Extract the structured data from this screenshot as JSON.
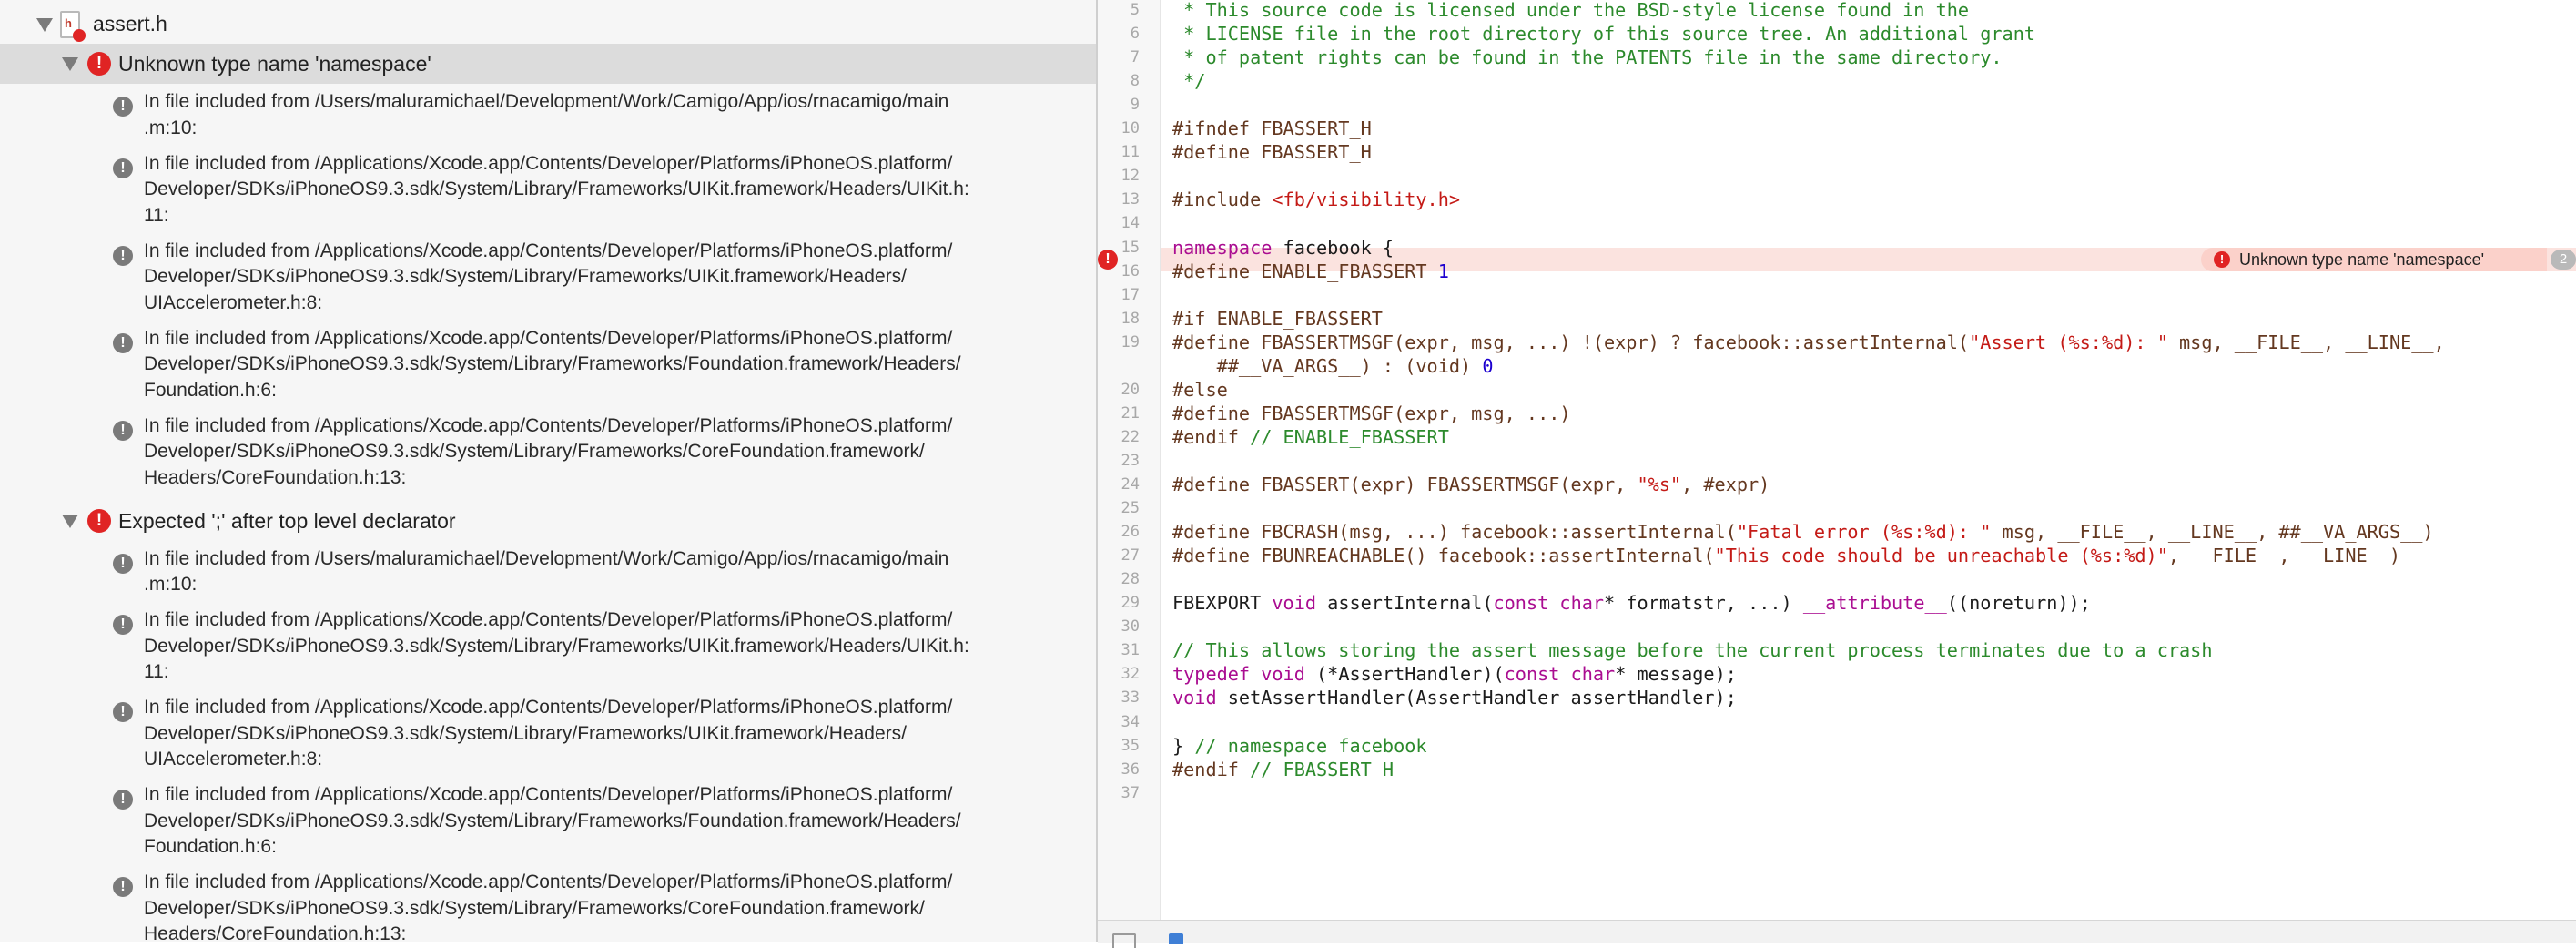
{
  "navigator": {
    "file": {
      "name": "assert.h",
      "icon": "header-file-icon"
    },
    "issues": [
      {
        "message": "Unknown type name 'namespace'",
        "notes": [
          "In file included from /Users/maluramichael/Development/Work/Camigo/App/ios/rnacamigo/main\n.m:10:",
          "In file included from /Applications/Xcode.app/Contents/Developer/Platforms/iPhoneOS.platform/\nDeveloper/SDKs/iPhoneOS9.3.sdk/System/Library/Frameworks/UIKit.framework/Headers/UIKit.h:\n11:",
          "In file included from /Applications/Xcode.app/Contents/Developer/Platforms/iPhoneOS.platform/\nDeveloper/SDKs/iPhoneOS9.3.sdk/System/Library/Frameworks/UIKit.framework/Headers/\nUIAccelerometer.h:8:",
          "In file included from /Applications/Xcode.app/Contents/Developer/Platforms/iPhoneOS.platform/\nDeveloper/SDKs/iPhoneOS9.3.sdk/System/Library/Frameworks/Foundation.framework/Headers/\nFoundation.h:6:",
          "In file included from /Applications/Xcode.app/Contents/Developer/Platforms/iPhoneOS.platform/\nDeveloper/SDKs/iPhoneOS9.3.sdk/System/Library/Frameworks/CoreFoundation.framework/\nHeaders/CoreFoundation.h:13:"
        ]
      },
      {
        "message": "Expected ';' after top level declarator",
        "notes": [
          "In file included from /Users/maluramichael/Development/Work/Camigo/App/ios/rnacamigo/main\n.m:10:",
          "In file included from /Applications/Xcode.app/Contents/Developer/Platforms/iPhoneOS.platform/\nDeveloper/SDKs/iPhoneOS9.3.sdk/System/Library/Frameworks/UIKit.framework/Headers/UIKit.h:\n11:",
          "In file included from /Applications/Xcode.app/Contents/Developer/Platforms/iPhoneOS.platform/\nDeveloper/SDKs/iPhoneOS9.3.sdk/System/Library/Frameworks/UIKit.framework/Headers/\nUIAccelerometer.h:8:",
          "In file included from /Applications/Xcode.app/Contents/Developer/Platforms/iPhoneOS.platform/\nDeveloper/SDKs/iPhoneOS9.3.sdk/System/Library/Frameworks/Foundation.framework/Headers/\nFoundation.h:6:",
          "In file included from /Applications/Xcode.app/Contents/Developer/Platforms/iPhoneOS.platform/\nDeveloper/SDKs/iPhoneOS9.3.sdk/System/Library/Frameworks/CoreFoundation.framework/\nHeaders/CoreFoundation.h:13:"
        ]
      }
    ]
  },
  "editor": {
    "inline_error": {
      "message": "Unknown type name 'namespace'",
      "count": "2",
      "line": "15"
    },
    "line_numbers": [
      "5",
      "6",
      "7",
      "8",
      "9",
      "10",
      "11",
      "12",
      "13",
      "14",
      "15",
      "16",
      "17",
      "18",
      "19",
      "",
      "20",
      "21",
      "22",
      "23",
      "24",
      "25",
      "26",
      "27",
      "28",
      "29",
      "30",
      "31",
      "32",
      "33",
      "34",
      "35",
      "36",
      "37"
    ],
    "lines": [
      [
        [
          "cmt",
          " * This source code is licensed under the BSD-style license found in the"
        ]
      ],
      [
        [
          "cmt",
          " * LICENSE file in the root directory of this source tree. An additional grant"
        ]
      ],
      [
        [
          "cmt",
          " * of patent rights can be found in the PATENTS file in the same directory."
        ]
      ],
      [
        [
          "cmt",
          " */"
        ]
      ],
      [
        [
          "ident",
          ""
        ]
      ],
      [
        [
          "pp",
          "#ifndef FBASSERT_H"
        ]
      ],
      [
        [
          "pp",
          "#define FBASSERT_H"
        ]
      ],
      [
        [
          "ident",
          ""
        ]
      ],
      [
        [
          "pp",
          "#include "
        ],
        [
          "str",
          "<fb/visibility.h>"
        ]
      ],
      [
        [
          "ident",
          ""
        ]
      ],
      [
        [
          "kw",
          "namespace"
        ],
        [
          "ident",
          " facebook {"
        ]
      ],
      [
        [
          "pp",
          "#define ENABLE_FBASSERT "
        ],
        [
          "num",
          "1"
        ]
      ],
      [
        [
          "ident",
          ""
        ]
      ],
      [
        [
          "pp",
          "#if ENABLE_FBASSERT"
        ]
      ],
      [
        [
          "pp",
          "#define FBASSERTMSGF(expr, msg, ...) !(expr) ? facebook::assertInternal("
        ],
        [
          "str",
          "\"Assert (%s:%d): \""
        ],
        [
          "pp",
          " msg, __FILE__, __LINE__,"
        ]
      ],
      [
        [
          "pp",
          "    ##__VA_ARGS__) : (void) "
        ],
        [
          "num",
          "0"
        ]
      ],
      [
        [
          "pp",
          "#else"
        ]
      ],
      [
        [
          "pp",
          "#define FBASSERTMSGF(expr, msg, ...)"
        ]
      ],
      [
        [
          "pp",
          "#endif "
        ],
        [
          "cmt",
          "// ENABLE_FBASSERT"
        ]
      ],
      [
        [
          "ident",
          ""
        ]
      ],
      [
        [
          "pp",
          "#define FBASSERT(expr) FBASSERTMSGF(expr, "
        ],
        [
          "str",
          "\"%s\""
        ],
        [
          "pp",
          ", #expr)"
        ]
      ],
      [
        [
          "ident",
          ""
        ]
      ],
      [
        [
          "pp",
          "#define FBCRASH(msg, ...) facebook::assertInternal("
        ],
        [
          "str",
          "\"Fatal error (%s:%d): \""
        ],
        [
          "pp",
          " msg, __FILE__, __LINE__, ##__VA_ARGS__)"
        ]
      ],
      [
        [
          "pp",
          "#define FBUNREACHABLE() facebook::assertInternal("
        ],
        [
          "str",
          "\"This code should be unreachable (%s:%d)\""
        ],
        [
          "pp",
          ", __FILE__, __LINE__)"
        ]
      ],
      [
        [
          "ident",
          ""
        ]
      ],
      [
        [
          "ident",
          "FBEXPORT "
        ],
        [
          "kw",
          "void"
        ],
        [
          "ident",
          " assertInternal("
        ],
        [
          "kw",
          "const"
        ],
        [
          "ident",
          " "
        ],
        [
          "kw",
          "char"
        ],
        [
          "ident",
          "* formatstr, ...) "
        ],
        [
          "kw",
          "__attribute__"
        ],
        [
          "ident",
          "((noreturn));"
        ]
      ],
      [
        [
          "ident",
          ""
        ]
      ],
      [
        [
          "cmt",
          "// This allows storing the assert message before the current process terminates due to a crash"
        ]
      ],
      [
        [
          "kw",
          "typedef"
        ],
        [
          "ident",
          " "
        ],
        [
          "kw",
          "void"
        ],
        [
          "ident",
          " (*AssertHandler)("
        ],
        [
          "kw",
          "const"
        ],
        [
          "ident",
          " "
        ],
        [
          "kw",
          "char"
        ],
        [
          "ident",
          "* message);"
        ]
      ],
      [
        [
          "kw",
          "void"
        ],
        [
          "ident",
          " setAssertHandler(AssertHandler assertHandler);"
        ]
      ],
      [
        [
          "ident",
          ""
        ]
      ],
      [
        [
          "ident",
          "} "
        ],
        [
          "cmt",
          "// namespace facebook"
        ]
      ],
      [
        [
          "pp",
          "#endif "
        ],
        [
          "cmt",
          "// FBASSERT_H"
        ]
      ],
      [
        [
          "ident",
          ""
        ]
      ]
    ]
  }
}
